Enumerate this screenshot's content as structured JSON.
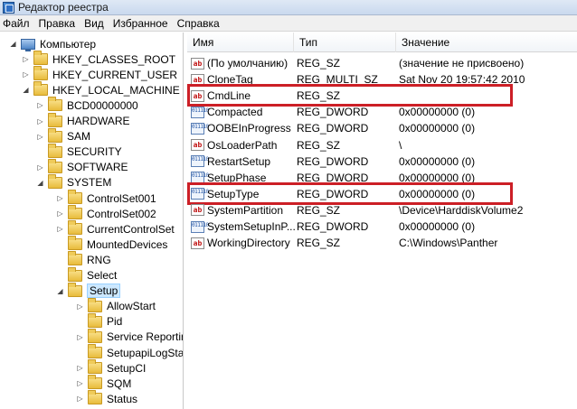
{
  "window": {
    "title": "Редактор реестра",
    "icon": "registry-editor-icon"
  },
  "menu": [
    "Файл",
    "Правка",
    "Вид",
    "Избранное",
    "Справка"
  ],
  "tree": [
    {
      "label": "Компьютер",
      "level": 0,
      "expander": "expanded",
      "icon": "computer-icon"
    },
    {
      "label": "HKEY_CLASSES_ROOT",
      "level": 1,
      "expander": "collapsed",
      "icon": "folder-icon"
    },
    {
      "label": "HKEY_CURRENT_USER",
      "level": 1,
      "expander": "collapsed",
      "icon": "folder-icon"
    },
    {
      "label": "HKEY_LOCAL_MACHINE",
      "level": 1,
      "expander": "expanded",
      "icon": "folder-icon"
    },
    {
      "label": "BCD00000000",
      "level": 2,
      "expander": "collapsed",
      "icon": "folder-icon"
    },
    {
      "label": "HARDWARE",
      "level": 2,
      "expander": "collapsed",
      "icon": "folder-icon"
    },
    {
      "label": "SAM",
      "level": 2,
      "expander": "collapsed",
      "icon": "folder-icon"
    },
    {
      "label": "SECURITY",
      "level": 2,
      "expander": "none",
      "icon": "folder-icon"
    },
    {
      "label": "SOFTWARE",
      "level": 2,
      "expander": "collapsed",
      "icon": "folder-icon"
    },
    {
      "label": "SYSTEM",
      "level": 2,
      "expander": "expanded",
      "icon": "folder-icon"
    },
    {
      "label": "ControlSet001",
      "level": 3,
      "expander": "collapsed",
      "icon": "folder-icon"
    },
    {
      "label": "ControlSet002",
      "level": 3,
      "expander": "collapsed",
      "icon": "folder-icon"
    },
    {
      "label": "CurrentControlSet",
      "level": 3,
      "expander": "collapsed",
      "icon": "folder-icon"
    },
    {
      "label": "MountedDevices",
      "level": 3,
      "expander": "none",
      "icon": "folder-icon"
    },
    {
      "label": "RNG",
      "level": 3,
      "expander": "none",
      "icon": "folder-icon"
    },
    {
      "label": "Select",
      "level": 3,
      "expander": "none",
      "icon": "folder-icon"
    },
    {
      "label": "Setup",
      "level": 3,
      "expander": "expanded",
      "icon": "folder-open-icon",
      "selected": true
    },
    {
      "label": "AllowStart",
      "level": 4,
      "expander": "collapsed",
      "icon": "folder-icon"
    },
    {
      "label": "Pid",
      "level": 4,
      "expander": "none",
      "icon": "folder-icon"
    },
    {
      "label": "Service Reporting",
      "level": 4,
      "expander": "collapsed",
      "icon": "folder-icon"
    },
    {
      "label": "SetupapiLogStatu",
      "level": 4,
      "expander": "none",
      "icon": "folder-icon"
    },
    {
      "label": "SetupCI",
      "level": 4,
      "expander": "collapsed",
      "icon": "folder-icon"
    },
    {
      "label": "SQM",
      "level": 4,
      "expander": "collapsed",
      "icon": "folder-icon"
    },
    {
      "label": "Status",
      "level": 4,
      "expander": "collapsed",
      "icon": "folder-icon"
    }
  ],
  "columns": {
    "name": "Имя",
    "type": "Тип",
    "value": "Значение"
  },
  "values": [
    {
      "name": "(По умолчанию)",
      "type": "REG_SZ",
      "data": "(значение не присвоено)",
      "icon": "string-value-icon",
      "glyph": "ab"
    },
    {
      "name": "CloneTag",
      "type": "REG_MULTI_SZ",
      "data": "Sat Nov 20 19:57:42 2010",
      "icon": "string-value-icon",
      "glyph": "ab"
    },
    {
      "name": "CmdLine",
      "type": "REG_SZ",
      "data": "",
      "icon": "string-value-icon",
      "glyph": "ab",
      "highlighted": true
    },
    {
      "name": "Compacted",
      "type": "REG_DWORD",
      "data": "0x00000000 (0)",
      "icon": "binary-value-icon",
      "glyph": "011110"
    },
    {
      "name": "OOBEInProgress",
      "type": "REG_DWORD",
      "data": "0x00000000 (0)",
      "icon": "binary-value-icon",
      "glyph": "011110"
    },
    {
      "name": "OsLoaderPath",
      "type": "REG_SZ",
      "data": "\\",
      "icon": "string-value-icon",
      "glyph": "ab"
    },
    {
      "name": "RestartSetup",
      "type": "REG_DWORD",
      "data": "0x00000000 (0)",
      "icon": "binary-value-icon",
      "glyph": "011110"
    },
    {
      "name": "SetupPhase",
      "type": "REG_DWORD",
      "data": "0x00000000 (0)",
      "icon": "binary-value-icon",
      "glyph": "011110"
    },
    {
      "name": "SetupType",
      "type": "REG_DWORD",
      "data": "0x00000000 (0)",
      "icon": "binary-value-icon",
      "glyph": "011110",
      "highlighted": true
    },
    {
      "name": "SystemPartition",
      "type": "REG_SZ",
      "data": "\\Device\\HarddiskVolume2",
      "icon": "string-value-icon",
      "glyph": "ab"
    },
    {
      "name": "SystemSetupInP...",
      "type": "REG_DWORD",
      "data": "0x00000000 (0)",
      "icon": "binary-value-icon",
      "glyph": "011110"
    },
    {
      "name": "WorkingDirectory",
      "type": "REG_SZ",
      "data": "C:\\Windows\\Panther",
      "icon": "string-value-icon",
      "glyph": "ab"
    }
  ],
  "colors": {
    "highlight_border": "#cc1f26",
    "selection": "#cce8ff"
  }
}
